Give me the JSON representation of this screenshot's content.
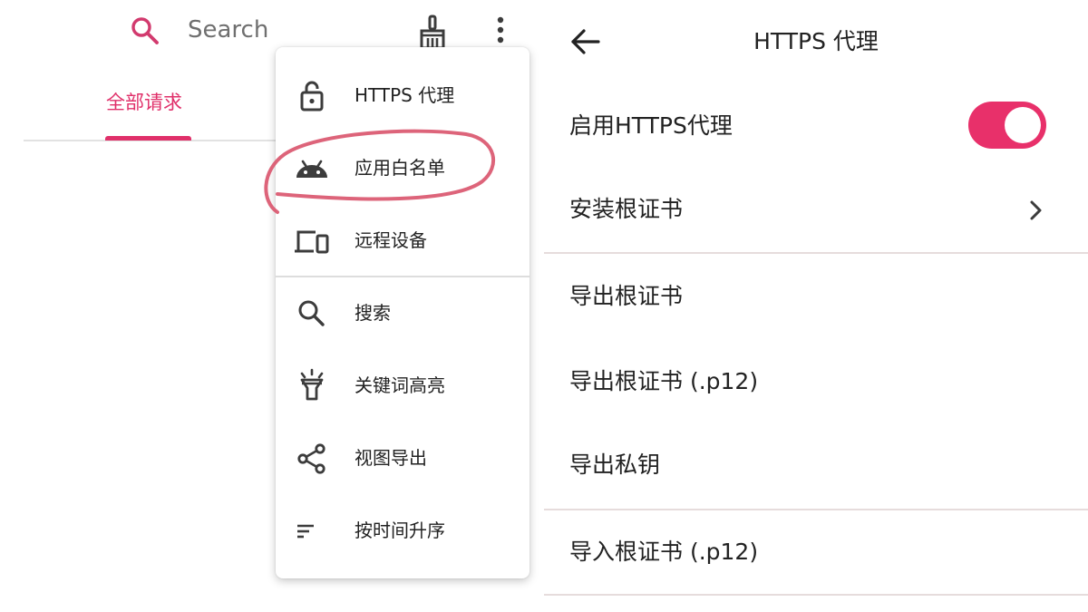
{
  "left": {
    "search": {
      "placeholder": "Search",
      "icon": "search-icon"
    },
    "toolbar": {
      "clear_icon": "broom-icon",
      "more_icon": "more-vert-icon"
    },
    "tabs": [
      {
        "label": "全部请求",
        "selected": true
      }
    ],
    "menu": {
      "items": [
        {
          "label": "HTTPS 代理",
          "icon": "unlock-icon"
        },
        {
          "label": "应用白名单",
          "icon": "android-icon"
        },
        {
          "label": "远程设备",
          "icon": "devices-icon"
        },
        {
          "label": "搜索",
          "icon": "search-icon"
        },
        {
          "label": "关键词高亮",
          "icon": "highlight-icon"
        },
        {
          "label": "视图导出",
          "icon": "share-icon"
        },
        {
          "label": "按时间升序",
          "icon": "sort-icon"
        }
      ]
    }
  },
  "right": {
    "title": "HTTPS 代理",
    "back_icon": "arrow-back-icon",
    "rows": [
      {
        "label": "启用HTTPS代理",
        "toggle": true
      },
      {
        "label": "安装根证书",
        "chevron": true
      },
      {
        "label": "导出根证书"
      },
      {
        "label": "导出根证书 (.p12)"
      },
      {
        "label": "导出私钥"
      },
      {
        "label": "导入根证书 (.p12)"
      }
    ]
  },
  "colors": {
    "accent": "#e0306a",
    "annotation": "#d9536c",
    "icon": "#3c3c3c",
    "divider": "#e6dcdc"
  }
}
